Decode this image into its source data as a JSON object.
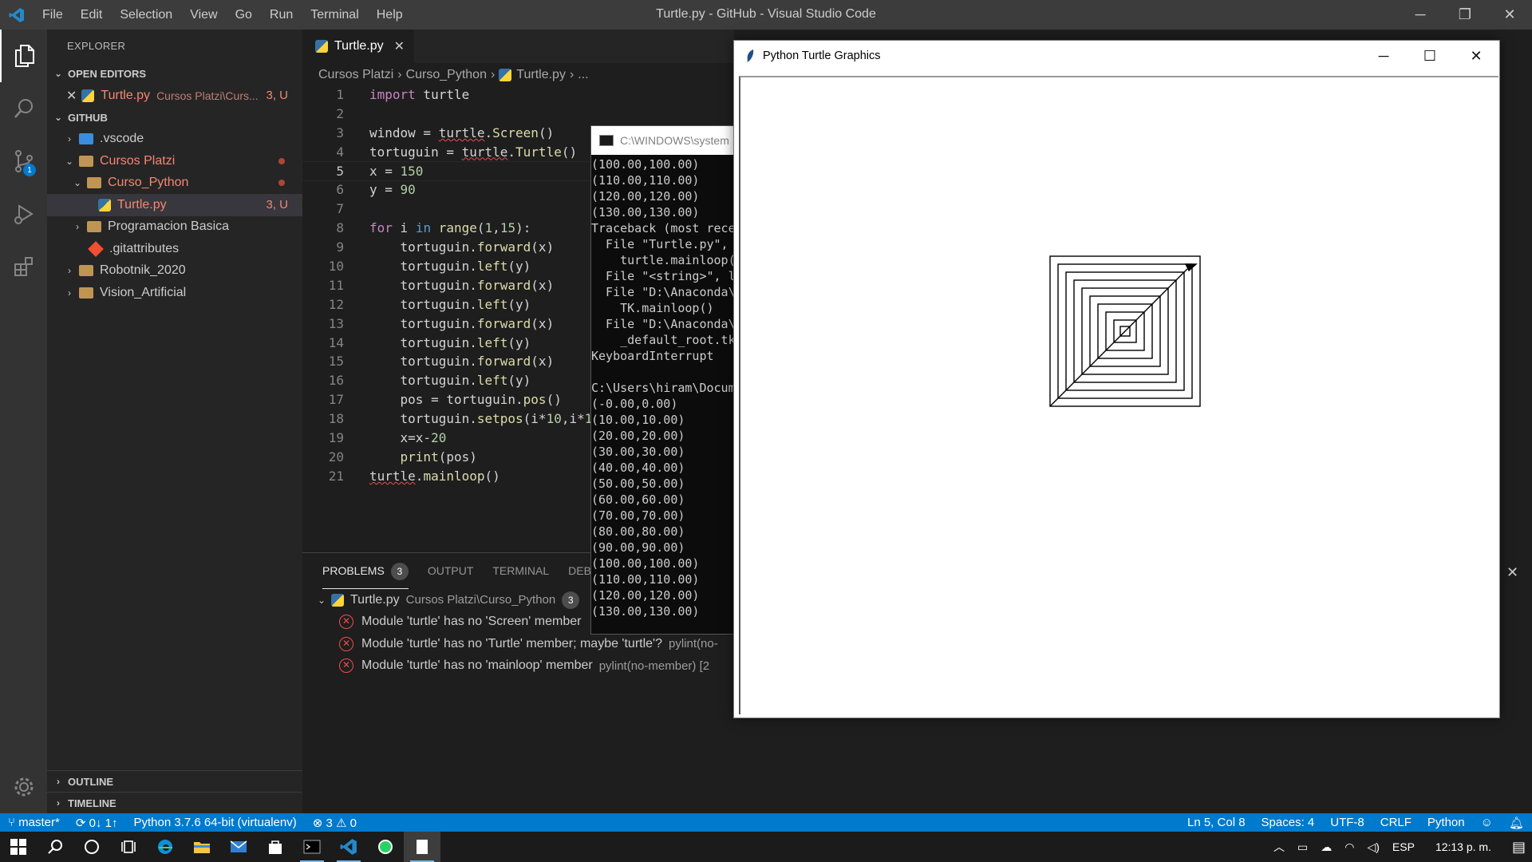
{
  "window": {
    "title": "Turtle.py - GitHub - Visual Studio Code",
    "menu": [
      "File",
      "Edit",
      "Selection",
      "View",
      "Go",
      "Run",
      "Terminal",
      "Help"
    ]
  },
  "activity": {
    "scm_badge": "1"
  },
  "sidebar": {
    "title": "EXPLORER",
    "open_editors": {
      "header": "OPEN EDITORS",
      "items": [
        {
          "name": "Turtle.py",
          "path": "Cursos Platzi\\Curs...",
          "status": "3, U"
        }
      ]
    },
    "workspace": {
      "header": "GITHUB",
      "tree": [
        {
          "label": ".vscode",
          "kind": "folder-vscode",
          "depth": 1,
          "chevron": "›"
        },
        {
          "label": "Cursos Platzi",
          "kind": "folder",
          "depth": 1,
          "chevron": "⌄",
          "modified": true
        },
        {
          "label": "Curso_Python",
          "kind": "folder",
          "depth": 2,
          "chevron": "⌄",
          "modified": true
        },
        {
          "label": "Turtle.py",
          "kind": "python",
          "depth": 3,
          "chevron": "",
          "status": "3, U",
          "selected": true
        },
        {
          "label": "Programacion Basica",
          "kind": "folder",
          "depth": 2,
          "chevron": "›"
        },
        {
          "label": ".gitattributes",
          "kind": "git",
          "depth": 2,
          "chevron": ""
        },
        {
          "label": "Robotnik_2020",
          "kind": "folder",
          "depth": 1,
          "chevron": "›"
        },
        {
          "label": "Vision_Artificial",
          "kind": "folder",
          "depth": 1,
          "chevron": "›"
        }
      ]
    },
    "outline": "OUTLINE",
    "timeline": "TIMELINE"
  },
  "editor": {
    "tab": "Turtle.py",
    "breadcrumb": [
      "Cursos Platzi",
      "Curso_Python",
      "Turtle.py",
      "..."
    ],
    "lines": [
      "import turtle",
      "",
      "window = turtle.Screen()",
      "tortuguin = turtle.Turtle()",
      "x = 150",
      "y = 90",
      "",
      "for i in range(1,15):",
      "    tortuguin.forward(x)",
      "    tortuguin.left(y)",
      "    tortuguin.forward(x)",
      "    tortuguin.left(y)",
      "    tortuguin.forward(x)",
      "    tortuguin.left(y)",
      "    tortuguin.forward(x)",
      "    tortuguin.left(y)",
      "    pos = tortuguin.pos()",
      "    tortuguin.setpos(i*10,i*1",
      "    x=x-20",
      "    print(pos)",
      "turtle.mainloop()"
    ]
  },
  "panel": {
    "tabs": [
      "PROBLEMS",
      "OUTPUT",
      "TERMINAL",
      "DEBUG"
    ],
    "problems_count": "3",
    "file": {
      "name": "Turtle.py",
      "path": "Cursos Platzi\\Curso_Python",
      "count": "3"
    },
    "problems": [
      {
        "msg": "Module 'turtle' has no 'Screen' member",
        "src": ""
      },
      {
        "msg": "Module 'turtle' has no 'Turtle' member; maybe 'turtle'?",
        "src": "pylint(no-"
      },
      {
        "msg": "Module 'turtle' has no 'mainloop' member",
        "src": "pylint(no-member)  [2"
      }
    ]
  },
  "console": {
    "title": "C:\\WINDOWS\\system",
    "lines": [
      "(100.00,100.00)",
      "(110.00,110.00)",
      "(120.00,120.00)",
      "(130.00,130.00)",
      "Traceback (most rece",
      "  File \"Turtle.py\",",
      "    turtle.mainloop(",
      "  File \"<string>\", l",
      "  File \"D:\\Anaconda\\",
      "    TK.mainloop()",
      "  File \"D:\\Anaconda\\",
      "    _default_root.tk",
      "KeyboardInterrupt",
      "",
      "C:\\Users\\hiram\\Docum",
      "(-0.00,0.00)",
      "(10.00,10.00)",
      "(20.00,20.00)",
      "(30.00,30.00)",
      "(40.00,40.00)",
      "(50.00,50.00)",
      "(60.00,60.00)",
      "(70.00,70.00)",
      "(80.00,80.00)",
      "(90.00,90.00)",
      "(100.00,100.00)",
      "(110.00,110.00)",
      "(120.00,120.00)",
      "(130.00,130.00)"
    ]
  },
  "turtle_window": {
    "title": "Python Turtle Graphics"
  },
  "statusbar": {
    "branch": "master*",
    "sync": "0↓ 1↑",
    "interpreter": "Python 3.7.6 64-bit (virtualenv)",
    "errors": "3",
    "warnings": "0",
    "position": "Ln 5, Col 8",
    "spaces": "Spaces: 4",
    "encoding": "UTF-8",
    "eol": "CRLF",
    "language": "Python"
  },
  "taskbar": {
    "lang": "ESP",
    "clock": "12:13 p. m."
  },
  "colors": {
    "accent": "#007acc",
    "error": "#f14c4c",
    "modified": "#e2c08d"
  }
}
